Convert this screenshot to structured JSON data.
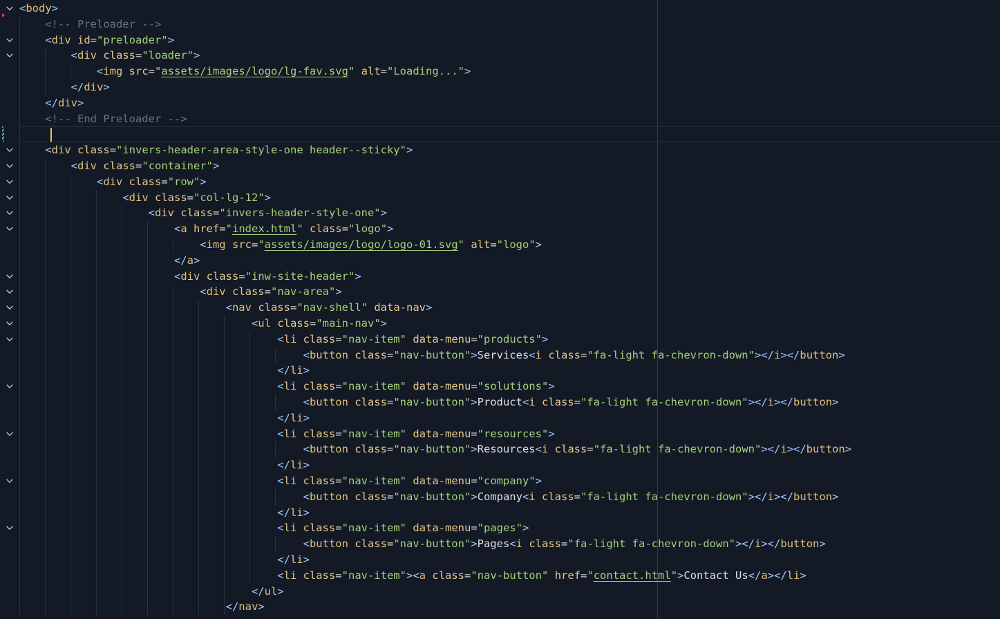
{
  "editor": {
    "language": "html",
    "colors": {
      "background": "#131a26",
      "tag": "#e5c07b",
      "attribute": "#e8c98a",
      "string": "#a4d17b",
      "comment": "#6b7280",
      "bracket": "#a1c7ff"
    },
    "icons": {
      "fold": "chevron-down-icon"
    },
    "lines": [
      "<body>",
      "    <!-- Preloader -->",
      "    <div id=\"preloader\">",
      "        <div class=\"loader\">",
      "            <img src=\"assets/images/logo/lg-fav.svg\" alt=\"Loading...\">",
      "        </div>",
      "    </div>",
      "    <!-- End Preloader -->",
      "",
      "    <div class=\"invers-header-area-style-one header--sticky\">",
      "        <div class=\"container\">",
      "            <div class=\"row\">",
      "                <div class=\"col-lg-12\">",
      "                    <div class=\"invers-header-style-one\">",
      "                        <a href=\"index.html\" class=\"logo\">",
      "                            <img src=\"assets/images/logo/logo-01.svg\" alt=\"logo\">",
      "                        </a>",
      "                        <div class=\"inw-site-header\">",
      "                            <div class=\"nav-area\">",
      "                                <nav class=\"nav-shell\" data-nav>",
      "                                    <ul class=\"main-nav\">",
      "                                        <li class=\"nav-item\" data-menu=\"products\">",
      "                                            <button class=\"nav-button\">Services<i class=\"fa-light fa-chevron-down\"></i></button>",
      "                                        </li>",
      "                                        <li class=\"nav-item\" data-menu=\"solutions\">",
      "                                            <button class=\"nav-button\">Product<i class=\"fa-light fa-chevron-down\"></i></button>",
      "                                        </li>",
      "                                        <li class=\"nav-item\" data-menu=\"resources\">",
      "                                            <button class=\"nav-button\">Resources<i class=\"fa-light fa-chevron-down\"></i></button>",
      "                                        </li>",
      "                                        <li class=\"nav-item\" data-menu=\"company\">",
      "                                            <button class=\"nav-button\">Company<i class=\"fa-light fa-chevron-down\"></i></button>",
      "                                        </li>",
      "                                        <li class=\"nav-item\" data-menu=\"pages\">",
      "                                            <button class=\"nav-button\">Pages<i class=\"fa-light fa-chevron-down\"></i></button>",
      "                                        </li>",
      "                                        <li class=\"nav-item\"><a class=\"nav-button\" href=\"contact.html\">Contact Us</a></li>",
      "                                    </ul>",
      "                                </nav>"
    ]
  }
}
